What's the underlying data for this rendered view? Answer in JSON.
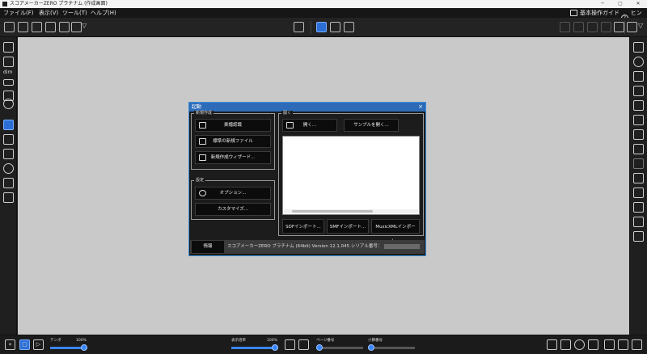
{
  "window": {
    "title": "スコアメーカーZERO プラチナム (作成画面)",
    "controls": [
      "─",
      "▢",
      "✕"
    ]
  },
  "menu": {
    "items": [
      "ファイル(F)",
      "表示(V)",
      "ツール(T)",
      "ヘルプ(H)"
    ],
    "guide_label": "基本操作ガイド",
    "hint_label": "ヒント"
  },
  "sidebar_left": {
    "dim_label": "dim"
  },
  "dialog": {
    "title": "起動",
    "close": "×",
    "new_group": {
      "label": "新規作成",
      "buttons": [
        "楽譜認識",
        "標準の新規ファイル",
        "新規作成ウィザード..."
      ]
    },
    "settings_group": {
      "label": "設定",
      "buttons": [
        "オプション...",
        "カスタマイズ..."
      ]
    },
    "open_group": {
      "label": "開く",
      "open_button": "開く...",
      "sample_button": "サンプルを開く...",
      "import_buttons": [
        "SDFインポート...",
        "SMFインポート...",
        "MusicXMLインポート..."
      ]
    },
    "info_button": "情報",
    "product_line": "スコアメーカーZERO プラチナム (64bit)   Version 12.1.045   シリアル番号："
  },
  "statusbar": {
    "tempo_label": "テンポ",
    "tempo_value": "100%",
    "tempo_level": 1.0,
    "zoom_label": "表示倍率",
    "zoom_value": "100%",
    "zoom_level": 1.0,
    "page_label": "ページ番号",
    "bar_label": "小節番号"
  }
}
